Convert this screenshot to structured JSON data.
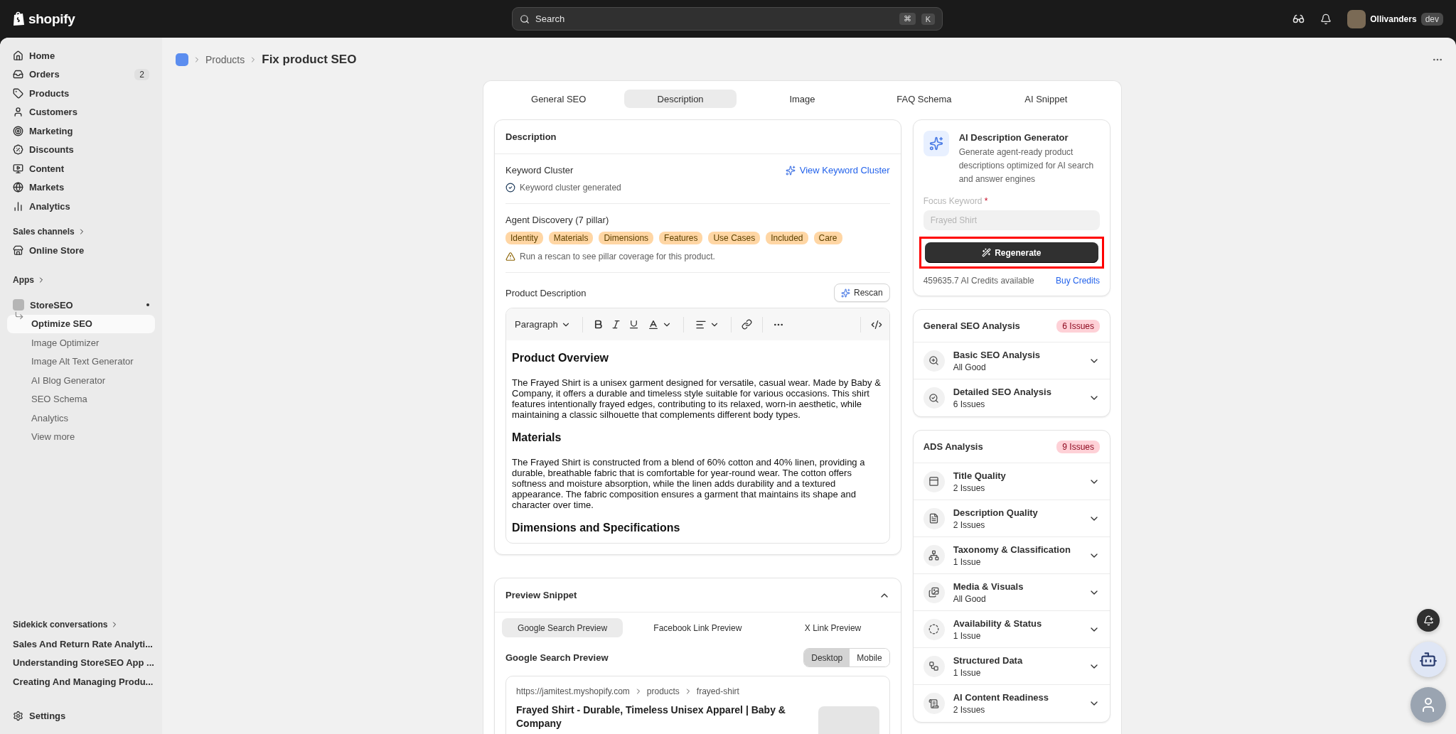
{
  "topbar": {
    "logo": "shopify",
    "search": {
      "placeholder": "Search",
      "keys": [
        "⌘",
        "K"
      ]
    },
    "store": "Ollivanders",
    "store_badge": "dev"
  },
  "sidebar": {
    "items": [
      {
        "label": "Home",
        "selected": false
      },
      {
        "label": "Orders",
        "badge": "2",
        "selected": false
      },
      {
        "label": "Products",
        "selected": false
      },
      {
        "label": "Customers",
        "selected": false
      },
      {
        "label": "Marketing",
        "selected": false
      },
      {
        "label": "Discounts",
        "selected": false
      },
      {
        "label": "Content",
        "selected": false
      },
      {
        "label": "Markets",
        "selected": false
      },
      {
        "label": "Analytics",
        "selected": false
      }
    ],
    "sales_channels": {
      "heading": "Sales channels",
      "items": [
        {
          "label": "Online Store",
          "selected": false
        }
      ]
    },
    "apps": {
      "heading": "Apps",
      "app": {
        "label": "StoreSEO",
        "pinned": true,
        "children": [
          {
            "label": "Optimize SEO",
            "selected": true
          },
          {
            "label": "Image Optimizer",
            "selected": false
          },
          {
            "label": "Image Alt Text Generator",
            "selected": false
          },
          {
            "label": "AI Blog Generator",
            "selected": false
          },
          {
            "label": "SEO Schema",
            "selected": false
          },
          {
            "label": "Analytics",
            "selected": false
          },
          {
            "label": "View more",
            "selected": false
          }
        ]
      }
    },
    "sidekick": {
      "heading": "Sidekick conversations",
      "items": [
        "Sales And Return Rate Analyti...",
        "Understanding StoreSEO App ...",
        "Creating And Managing Produ..."
      ]
    },
    "settings": "Settings"
  },
  "breadcrumb": {
    "parent": "Products",
    "title": "Fix product SEO"
  },
  "tabs": [
    {
      "label": "General SEO",
      "selected": false
    },
    {
      "label": "Description",
      "selected": true
    },
    {
      "label": "Image",
      "selected": false
    },
    {
      "label": "FAQ Schema",
      "selected": false
    },
    {
      "label": "AI Snippet",
      "selected": false
    }
  ],
  "description_card": {
    "title": "Description",
    "keyword_cluster": {
      "label": "Keyword Cluster",
      "link": "View Keyword Cluster",
      "status": "Keyword cluster generated"
    },
    "agent_discovery": {
      "label": "Agent Discovery (7 pillar)",
      "pillars": [
        "Identity",
        "Materials",
        "Dimensions",
        "Features",
        "Use Cases",
        "Included",
        "Care"
      ],
      "warning": "Run a rescan to see pillar coverage for this product."
    },
    "product_description": {
      "label": "Product Description",
      "rescan": "Rescan",
      "format": "Paragraph",
      "content": [
        {
          "kind": "heading",
          "text": "Product Overview"
        },
        {
          "kind": "paragraph",
          "text": "The Frayed Shirt is a unisex garment designed for versatile, casual wear. Made by Baby & Company, it offers a durable and timeless style suitable for various occasions. This shirt features intentionally frayed edges, contributing to its relaxed, worn-in aesthetic, while maintaining a classic silhouette that complements different body types."
        },
        {
          "kind": "heading",
          "text": "Materials"
        },
        {
          "kind": "paragraph",
          "text": "The Frayed Shirt is constructed from a blend of 60% cotton and 40% linen, providing a durable, breathable fabric that is comfortable for year-round wear. The cotton offers softness and moisture absorption, while the linen adds durability and a textured appearance. The fabric composition ensures a garment that maintains its shape and character over time."
        },
        {
          "kind": "heading",
          "text": "Dimensions and Specifications"
        }
      ]
    }
  },
  "preview_card": {
    "title": "Preview Snippet",
    "expanded": true,
    "tabs": [
      {
        "label": "Google Search Preview",
        "selected": true
      },
      {
        "label": "Facebook Link Preview",
        "selected": false
      },
      {
        "label": "X Link Preview",
        "selected": false
      }
    ],
    "heading": "Google Search Preview",
    "devices": [
      {
        "label": "Desktop",
        "selected": true
      },
      {
        "label": "Mobile",
        "selected": false
      }
    ],
    "result": {
      "url": [
        "https://jamitest.myshopify.com",
        "products",
        "frayed-shirt"
      ],
      "title": "Frayed Shirt - Durable, Timeless Unisex Apparel | Baby & Company"
    }
  },
  "ai_card": {
    "title": "AI Description Generator",
    "description": "Generate agent-ready product descriptions optimized for AI search and answer engines",
    "field_label": "Focus Keyword",
    "required_mark": "*",
    "field_value": "Frayed Shirt",
    "button": "Regenerate",
    "highlighted": true,
    "credits": "459635.7 AI Credits available",
    "buy": "Buy Credits"
  },
  "analysis": [
    {
      "title": "General SEO Analysis",
      "badge": "6 Issues",
      "items": [
        {
          "title": "Basic SEO Analysis",
          "status": "All Good",
          "expanded": false
        },
        {
          "title": "Detailed SEO Analysis",
          "status": "6 Issues",
          "expanded": false
        }
      ]
    },
    {
      "title": "ADS Analysis",
      "badge": "9 Issues",
      "items": [
        {
          "title": "Title Quality",
          "status": "2 Issues",
          "expanded": false
        },
        {
          "title": "Description Quality",
          "status": "2 Issues",
          "expanded": false
        },
        {
          "title": "Taxonomy & Classification",
          "status": "1 Issue",
          "expanded": false
        },
        {
          "title": "Media & Visuals",
          "status": "All Good",
          "expanded": false
        },
        {
          "title": "Availability & Status",
          "status": "1 Issue",
          "expanded": false
        },
        {
          "title": "Structured Data",
          "status": "1 Issue",
          "expanded": false
        },
        {
          "title": "AI Content Readiness",
          "status": "2 Issues",
          "expanded": false
        }
      ]
    }
  ]
}
